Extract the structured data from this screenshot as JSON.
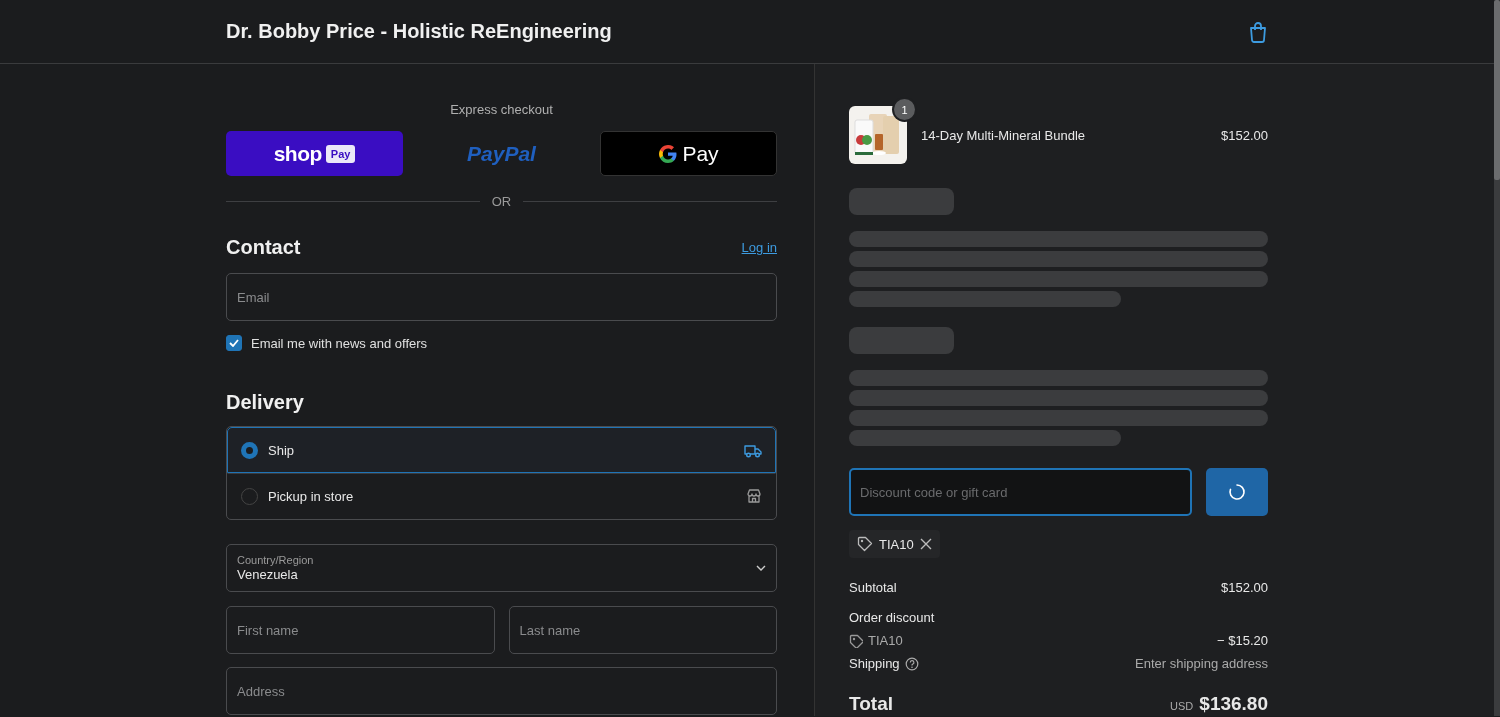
{
  "header": {
    "store_name": "Dr. Bobby Price - Holistic ReEngineering"
  },
  "express_checkout": {
    "title": "Express checkout",
    "buttons": [
      {
        "kind": "shoppay",
        "label": "shop",
        "badge": "Pay"
      },
      {
        "kind": "paypal",
        "label": "PayPal"
      },
      {
        "kind": "gpay",
        "label": "Pay"
      }
    ],
    "divider": "OR"
  },
  "contact": {
    "heading": "Contact",
    "login_link": "Log in",
    "email": {
      "placeholder": "Email"
    },
    "newsletter": {
      "label": "Email me with news and offers",
      "checked": true
    }
  },
  "delivery": {
    "heading": "Delivery",
    "options": [
      {
        "label": "Ship",
        "kind": "ship",
        "selected": true
      },
      {
        "label": "Pickup in store",
        "kind": "store",
        "selected": false
      }
    ],
    "country": {
      "label": "Country/Region",
      "value": "Venezuela"
    },
    "first_name": {
      "placeholder": "First name"
    },
    "last_name": {
      "placeholder": "Last name"
    },
    "address": {
      "placeholder": "Address"
    }
  },
  "summary": {
    "items": [
      {
        "name": "14-Day Multi-Mineral Bundle",
        "quantity": "1",
        "price": "$152.00"
      }
    ],
    "loading": true,
    "discount": {
      "placeholder": "Discount code or gift card",
      "focused": true,
      "button_loading": true
    },
    "applied_codes": [
      {
        "code": "TIA10"
      }
    ],
    "subtotal": {
      "label": "Subtotal",
      "value": "$152.00"
    },
    "order_discount": {
      "label": "Order discount",
      "code": "TIA10",
      "value": "− $15.20"
    },
    "shipping": {
      "label": "Shipping",
      "value": "Enter shipping address"
    },
    "total": {
      "label": "Total",
      "currency": "USD",
      "value": "$136.80"
    }
  }
}
